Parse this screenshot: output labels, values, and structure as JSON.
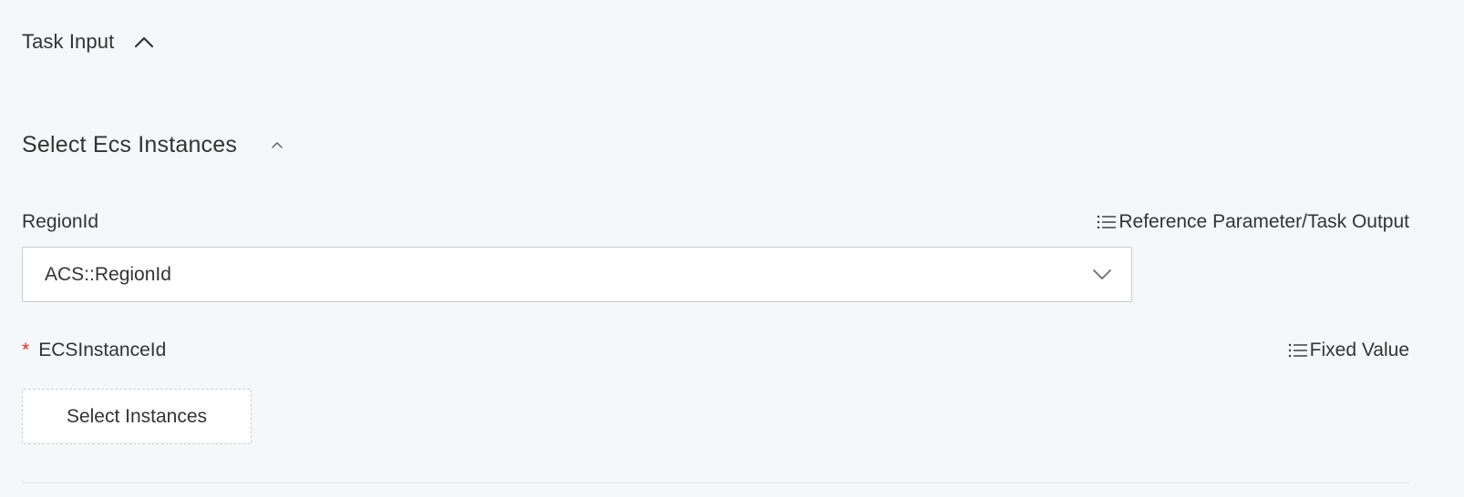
{
  "task_input": {
    "title": "Task Input",
    "toggle_icon": "chevron-up-icon"
  },
  "section": {
    "title": "Select Ecs Instances",
    "toggle_icon": "chevron-up-icon"
  },
  "region_field": {
    "label": "RegionId",
    "action_icon": "list-icon",
    "action_label": "Reference Parameter/Task Output",
    "value": "ACS::RegionId",
    "dropdown_icon": "chevron-down-icon"
  },
  "instance_field": {
    "required_mark": "*",
    "label": "ECSInstanceId",
    "action_icon": "list-icon",
    "action_label": "Fixed Value",
    "button_label": "Select Instances"
  },
  "colors": {
    "background": "#f6f7f8",
    "text": "#333333",
    "required": "#d93026",
    "border": "#c9cdd2"
  }
}
